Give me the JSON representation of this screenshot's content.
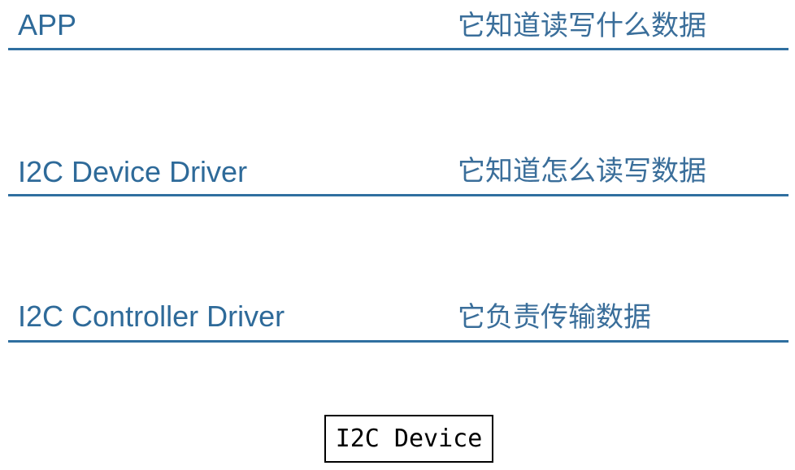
{
  "layers": [
    {
      "name": "APP",
      "description": "它知道读写什么数据"
    },
    {
      "name": "I2C Device Driver",
      "description": "它知道怎么读写数据"
    },
    {
      "name": "I2C Controller Driver",
      "description": "它负责传输数据"
    }
  ],
  "device": {
    "label": "I2C Device"
  },
  "colors": {
    "text": "#2e6a99",
    "line": "#2f6fa0",
    "box_border": "#000000"
  }
}
